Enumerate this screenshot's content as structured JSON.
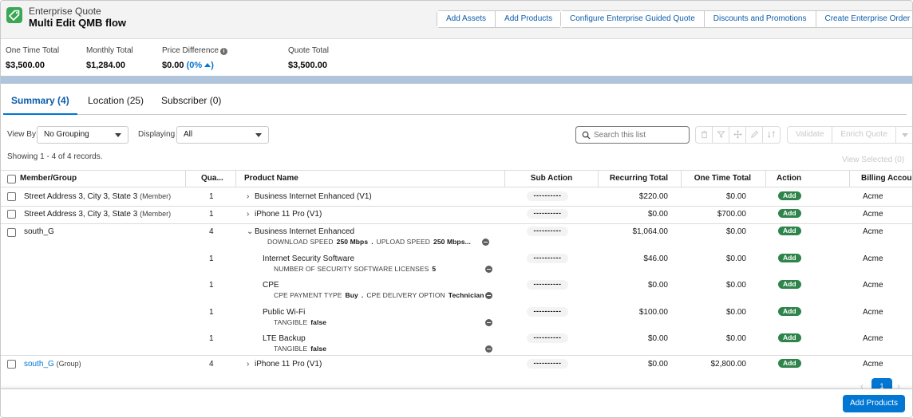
{
  "header": {
    "object_type": "Enterprise Quote",
    "record_name": "Multi Edit QMB flow",
    "actions_left": [
      "Add Assets",
      "Add Products"
    ],
    "actions_right": [
      "Configure Enterprise Guided Quote",
      "Discounts and Promotions",
      "Create Enterprise Order"
    ],
    "icon": "price-tag-icon",
    "icon_color": "#3ba755"
  },
  "totals": {
    "one_time": {
      "label": "One Time Total",
      "value": "$3,500.00"
    },
    "monthly": {
      "label": "Monthly Total",
      "value": "$1,284.00"
    },
    "price_diff": {
      "label": "Price Difference",
      "value": "$0.00",
      "pct": "(0%"
    },
    "quote": {
      "label": "Quote Total",
      "value": "$3,500.00"
    }
  },
  "tabs": [
    "Summary (4)",
    "Location (25)",
    "Subscriber (0)"
  ],
  "toolbar": {
    "view_by_label": "View By",
    "view_by_value": "No Grouping",
    "displaying_label": "Displaying",
    "displaying_value": "All",
    "search_placeholder": "Search this list",
    "validate": "Validate",
    "enrich": "Enrich Quote",
    "showing": "Showing 1 - 4 of 4 records.",
    "view_selected": "View Selected (0)"
  },
  "columns": [
    "Member/Group",
    "Qua...",
    "Product Name",
    "Sub Action",
    "Recurring Total",
    "One Time Total",
    "Action",
    "Billing Accou"
  ],
  "rows": [
    {
      "member": "Street Address 3, City 3, State 3",
      "member_tag": "(Member)",
      "qty": "1",
      "product": "Business Internet Enhanced (V1)",
      "sub": "----------",
      "recurring": "$220.00",
      "onetime": "$0.00",
      "action": "Add",
      "billing": "Acme"
    },
    {
      "member": "Street Address 3, City 3, State 3",
      "member_tag": "(Member)",
      "qty": "1",
      "product": "iPhone 11 Pro (V1)",
      "sub": "----------",
      "recurring": "$0.00",
      "onetime": "$700.00",
      "action": "Add",
      "billing": "Acme"
    },
    {
      "member": "south_G",
      "member_tag": "",
      "qty": "4",
      "product": "Business Internet Enhanced",
      "sub": "----------",
      "recurring": "$1,064.00",
      "onetime": "$0.00",
      "action": "Add",
      "billing": "Acme",
      "attrs": [
        {
          "k": "DOWNLOAD SPEED",
          "v": "250 Mbps"
        },
        {
          "k": "UPLOAD SPEED",
          "v": "250 Mbps..."
        }
      ]
    },
    {
      "member": "",
      "qty": "1",
      "product": "Internet Security Software",
      "sub": "----------",
      "recurring": "$46.00",
      "onetime": "$0.00",
      "action": "Add",
      "billing": "Acme",
      "attrs": [
        {
          "k": "NUMBER OF SECURITY SOFTWARE LICENSES",
          "v": "5"
        }
      ]
    },
    {
      "member": "",
      "qty": "1",
      "product": "CPE",
      "sub": "----------",
      "recurring": "$0.00",
      "onetime": "$0.00",
      "action": "Add",
      "billing": "Acme",
      "attrs": [
        {
          "k": "CPE PAYMENT TYPE",
          "v": "Buy"
        },
        {
          "k": "CPE DELIVERY OPTION",
          "v": "Technician"
        }
      ]
    },
    {
      "member": "",
      "qty": "1",
      "product": "Public Wi-Fi",
      "sub": "----------",
      "recurring": "$100.00",
      "onetime": "$0.00",
      "action": "Add",
      "billing": "Acme",
      "attrs": [
        {
          "k": "TANGIBLE",
          "v": "false"
        }
      ]
    },
    {
      "member": "",
      "qty": "1",
      "product": "LTE Backup",
      "sub": "----------",
      "recurring": "$0.00",
      "onetime": "$0.00",
      "action": "Add",
      "billing": "Acme",
      "attrs": [
        {
          "k": "TANGIBLE",
          "v": "false"
        }
      ]
    },
    {
      "member": "south_G",
      "member_tag": "(Group)",
      "qty": "4",
      "product": "iPhone 11 Pro (V1)",
      "sub": "----------",
      "recurring": "$0.00",
      "onetime": "$2,800.00",
      "action": "Add",
      "billing": "Acme"
    }
  ],
  "pager": {
    "page": "1"
  },
  "footer": {
    "primary": "Add Products"
  },
  "colors": {
    "brand": "#0176d3",
    "success": "#2e844a",
    "band": "#b0c4dc"
  }
}
